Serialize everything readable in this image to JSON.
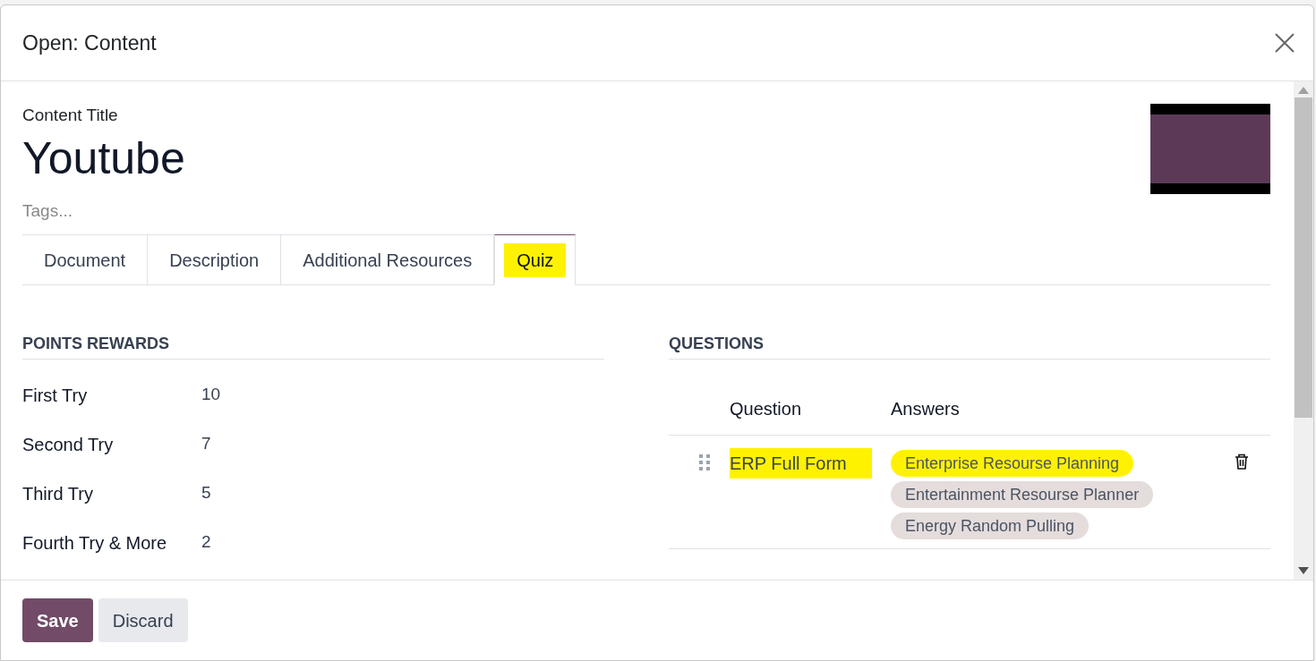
{
  "dialog": {
    "title": "Open: Content"
  },
  "content_title_label": "Content Title",
  "content_title": "Youtube",
  "tags": {
    "placeholder": "Tags..."
  },
  "tabs": [
    {
      "label": "Document",
      "selected": false,
      "highlighted": false
    },
    {
      "label": "Description",
      "selected": false,
      "highlighted": false
    },
    {
      "label": "Additional Resources",
      "selected": false,
      "highlighted": false
    },
    {
      "label": "Quiz",
      "selected": true,
      "highlighted": true
    }
  ],
  "points_rewards": {
    "heading": "POINTS REWARDS",
    "rows": [
      {
        "label": "First Try",
        "value": "10"
      },
      {
        "label": "Second Try",
        "value": "7"
      },
      {
        "label": "Third Try",
        "value": "5"
      },
      {
        "label": "Fourth Try & More",
        "value": "2"
      }
    ]
  },
  "questions": {
    "heading": "QUESTIONS",
    "columns": [
      "Question",
      "Answers"
    ],
    "rows": [
      {
        "question": "ERP Full Form",
        "highlighted": true,
        "answers": [
          {
            "text": "Enterprise Resourse Planning",
            "highlighted": true
          },
          {
            "text": "Entertainment Resourse Planner",
            "highlighted": false
          },
          {
            "text": "Energy Random Pulling",
            "highlighted": false
          }
        ]
      }
    ]
  },
  "buttons": [
    {
      "label": "Save",
      "kind": "primary"
    },
    {
      "label": "Discard",
      "kind": "secondary"
    }
  ]
}
